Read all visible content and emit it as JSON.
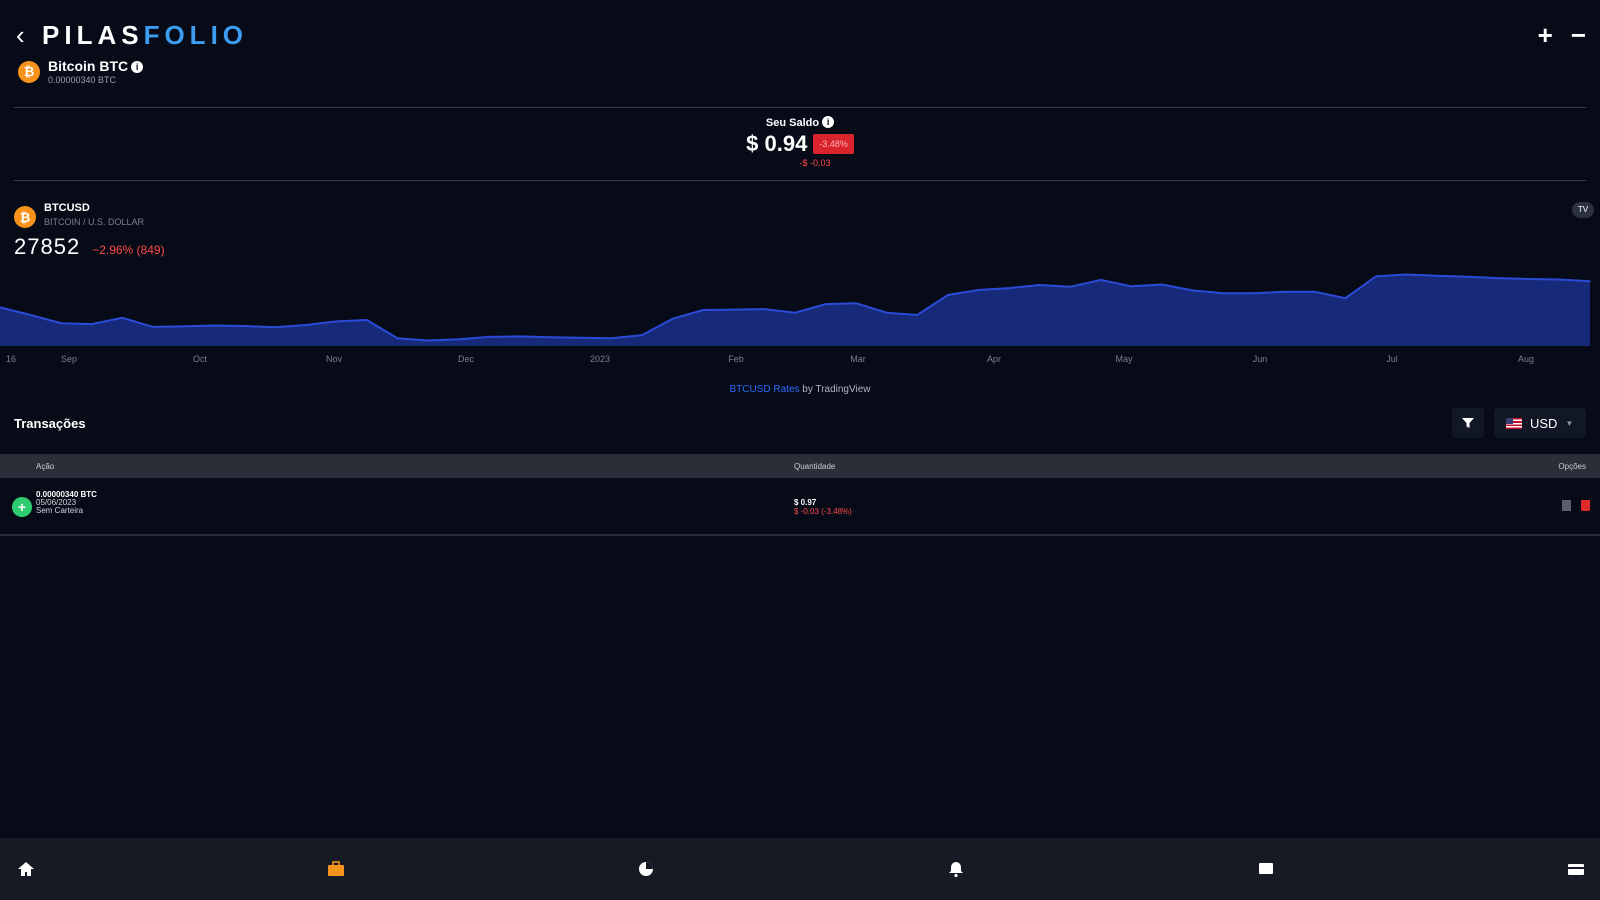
{
  "header": {
    "brand_part1": "PILAS",
    "brand_part2": "FOLIO",
    "asset_name": "Bitcoin BTC",
    "asset_info_icon": "info-icon",
    "asset_sub": "0.00000340 BTC",
    "coin_symbol": "₿",
    "back_icon": "chevron-left-icon",
    "add_icon": "plus-icon",
    "remove_icon": "minus-icon"
  },
  "balance": {
    "label": "Seu Saldo",
    "value": "$ 0.94",
    "badge": "-3.48%",
    "sub": "-$ -0.03"
  },
  "widget": {
    "symbol": "BTCUSD",
    "description": "BITCOIN / U.S. DOLLAR",
    "price": "27852",
    "change": "−2.96% (849)",
    "logo_icon": "tradingview-logo-icon"
  },
  "chart_data": {
    "type": "area",
    "x": [
      "Aug 16",
      "Aug 23",
      "Aug 30",
      "Sep 06",
      "Sep 13",
      "Sep 20",
      "Sep 27",
      "Oct 04",
      "Oct 11",
      "Oct 18",
      "Oct 25",
      "Nov 01",
      "Nov 08",
      "Nov 15",
      "Nov 22",
      "Nov 29",
      "Dec 06",
      "Dec 13",
      "Dec 20",
      "Dec 27",
      "Jan 03",
      "Jan 10",
      "Jan 17",
      "Jan 24",
      "Jan 31",
      "Feb 07",
      "Feb 14",
      "Feb 21",
      "Feb 28",
      "Mar 07",
      "Mar 14",
      "Mar 21",
      "Mar 28",
      "Apr 04",
      "Apr 11",
      "Apr 18",
      "Apr 25",
      "May 02",
      "May 09",
      "May 16",
      "May 23",
      "May 30",
      "Jun 06",
      "Jun 13",
      "Jun 20",
      "Jun 27",
      "Jul 04",
      "Jul 11",
      "Jul 18",
      "Jul 25",
      "Aug 01",
      "Aug 08",
      "Aug 15"
    ],
    "values": [
      23500,
      21800,
      20000,
      19800,
      21200,
      19200,
      19300,
      19500,
      19400,
      19100,
      19600,
      20400,
      20700,
      16700,
      16200,
      16500,
      17000,
      17100,
      16900,
      16800,
      16700,
      17400,
      21000,
      22900,
      23000,
      23100,
      22300,
      24200,
      24400,
      22300,
      21800,
      26200,
      27300,
      27700,
      28400,
      28000,
      29500,
      28100,
      28500,
      27200,
      26600,
      26600,
      26900,
      26900,
      25500,
      30300,
      30700,
      30400,
      30200,
      29900,
      29700,
      29600,
      29200
    ],
    "x_ticks": [
      "16",
      "Sep",
      "Oct",
      "Nov",
      "Dec",
      "2023",
      "Feb",
      "Mar",
      "Apr",
      "May",
      "Jun",
      "Jul",
      "Aug"
    ],
    "line_color": "#2a4bd6",
    "fill_color": "#172a7a"
  },
  "attribution": {
    "link": "BTCUSD Rates",
    "by": "by TradingView"
  },
  "transactions": {
    "title": "Transações",
    "filter_icon": "filter-icon",
    "currency": "USD",
    "currency_flag": "us-flag-icon",
    "columns": [
      "Ação",
      "Quantidade",
      "Opções"
    ],
    "rows": [
      {
        "type_icon": "plus-icon",
        "amount": "0.00000340 BTC",
        "date": "05/06/2023",
        "note": "Sem Carteira",
        "qty": "$ 0.97",
        "qty_change": "$ -0.03 (-3.48%)",
        "edit_icon": "edit-icon",
        "delete_icon": "trash-icon"
      }
    ]
  },
  "nav": {
    "items": [
      "home-icon",
      "briefcase-icon",
      "pie-chart-icon",
      "bell-icon",
      "message-icon",
      "card-icon"
    ]
  }
}
